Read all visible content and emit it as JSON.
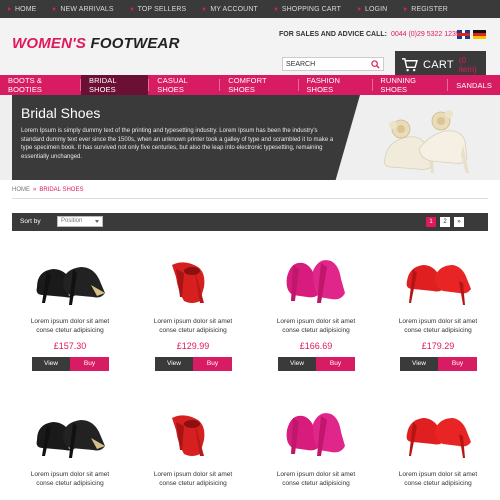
{
  "topnav": {
    "items": [
      {
        "label": "HOME"
      },
      {
        "label": "NEW ARRIVALS"
      },
      {
        "label": "TOP SELLERS"
      },
      {
        "label": "MY ACCOUNT"
      },
      {
        "label": "SHOPPING CART"
      },
      {
        "label": "LOGIN"
      },
      {
        "label": "REGISTER"
      }
    ]
  },
  "header": {
    "logo_part1": "WOMEN'S",
    "logo_part2": "FOOTWEAR",
    "advice_label": "FOR SALES AND ADVICE CALL:",
    "phone": "0044 (0)29 5322 1235",
    "flags": [
      "uk-flag-icon",
      "germany-flag-icon"
    ]
  },
  "search": {
    "value": "SEARCH"
  },
  "cart": {
    "label": "CART",
    "count": "(0 item)"
  },
  "nav": {
    "items": [
      {
        "label": "BOOTS & BOOTIES"
      },
      {
        "label": "BRIDAL SHOES",
        "active": true
      },
      {
        "label": "CASUAL SHOES"
      },
      {
        "label": "COMFORT SHOES"
      },
      {
        "label": "FASHION SHOES"
      },
      {
        "label": "RUNNING SHOES"
      },
      {
        "label": "SANDALS"
      }
    ]
  },
  "banner": {
    "title": "Bridal Shoes",
    "text": "Lorem Ipsum is simply dummy text of the printing and typesetting industry. Lorem Ipsum has been the industry's standard dummy text ever since the 1500s, when an unknown printer took a galley of type and scrambled it to make a type specimen book. It has survived not only five centuries, but also the leap into electronic typesetting, remaining essentially unchanged."
  },
  "breadcrumb": {
    "home": "HOME",
    "separator": "»",
    "current": "BRIDAL SHOES"
  },
  "sort": {
    "label": "Sort by",
    "selected": "Position"
  },
  "pagination": {
    "pages": [
      "1",
      "2",
      "»"
    ],
    "active": "1"
  },
  "product_buttons": {
    "view": "View",
    "buy": "Buy"
  },
  "products": [
    {
      "name_line1": "Lorem ipsum dolor sit amet",
      "name_line2": "conse ctetur adipisicing",
      "price": "£157.30",
      "style": "black-gold-pump"
    },
    {
      "name_line1": "Lorem ipsum dolor sit amet",
      "name_line2": "conse ctetur adipisicing",
      "price": "£129.99",
      "style": "red-suede-pump"
    },
    {
      "name_line1": "Lorem ipsum dolor sit amet",
      "name_line2": "conse ctetur adipisicing",
      "price": "£166.69",
      "style": "pink-platform-pump"
    },
    {
      "name_line1": "Lorem ipsum dolor sit amet",
      "name_line2": "conse ctetur adipisicing",
      "price": "£179.29",
      "style": "red-stiletto"
    },
    {
      "name_line1": "Lorem ipsum dolor sit amet",
      "name_line2": "conse ctetur adipisicing",
      "price": "",
      "style": "black-gold-pump"
    },
    {
      "name_line1": "Lorem ipsum dolor sit amet",
      "name_line2": "conse ctetur adipisicing",
      "price": "",
      "style": "red-suede-pump"
    },
    {
      "name_line1": "Lorem ipsum dolor sit amet",
      "name_line2": "conse ctetur adipisicing",
      "price": "",
      "style": "pink-platform-pump"
    },
    {
      "name_line1": "Lorem ipsum dolor sit amet",
      "name_line2": "conse ctetur adipisicing",
      "price": "",
      "style": "red-stiletto"
    }
  ],
  "colors": {
    "accent": "#d81c63",
    "dark": "#3a3a3a",
    "nav_active": "#6b0f35"
  }
}
